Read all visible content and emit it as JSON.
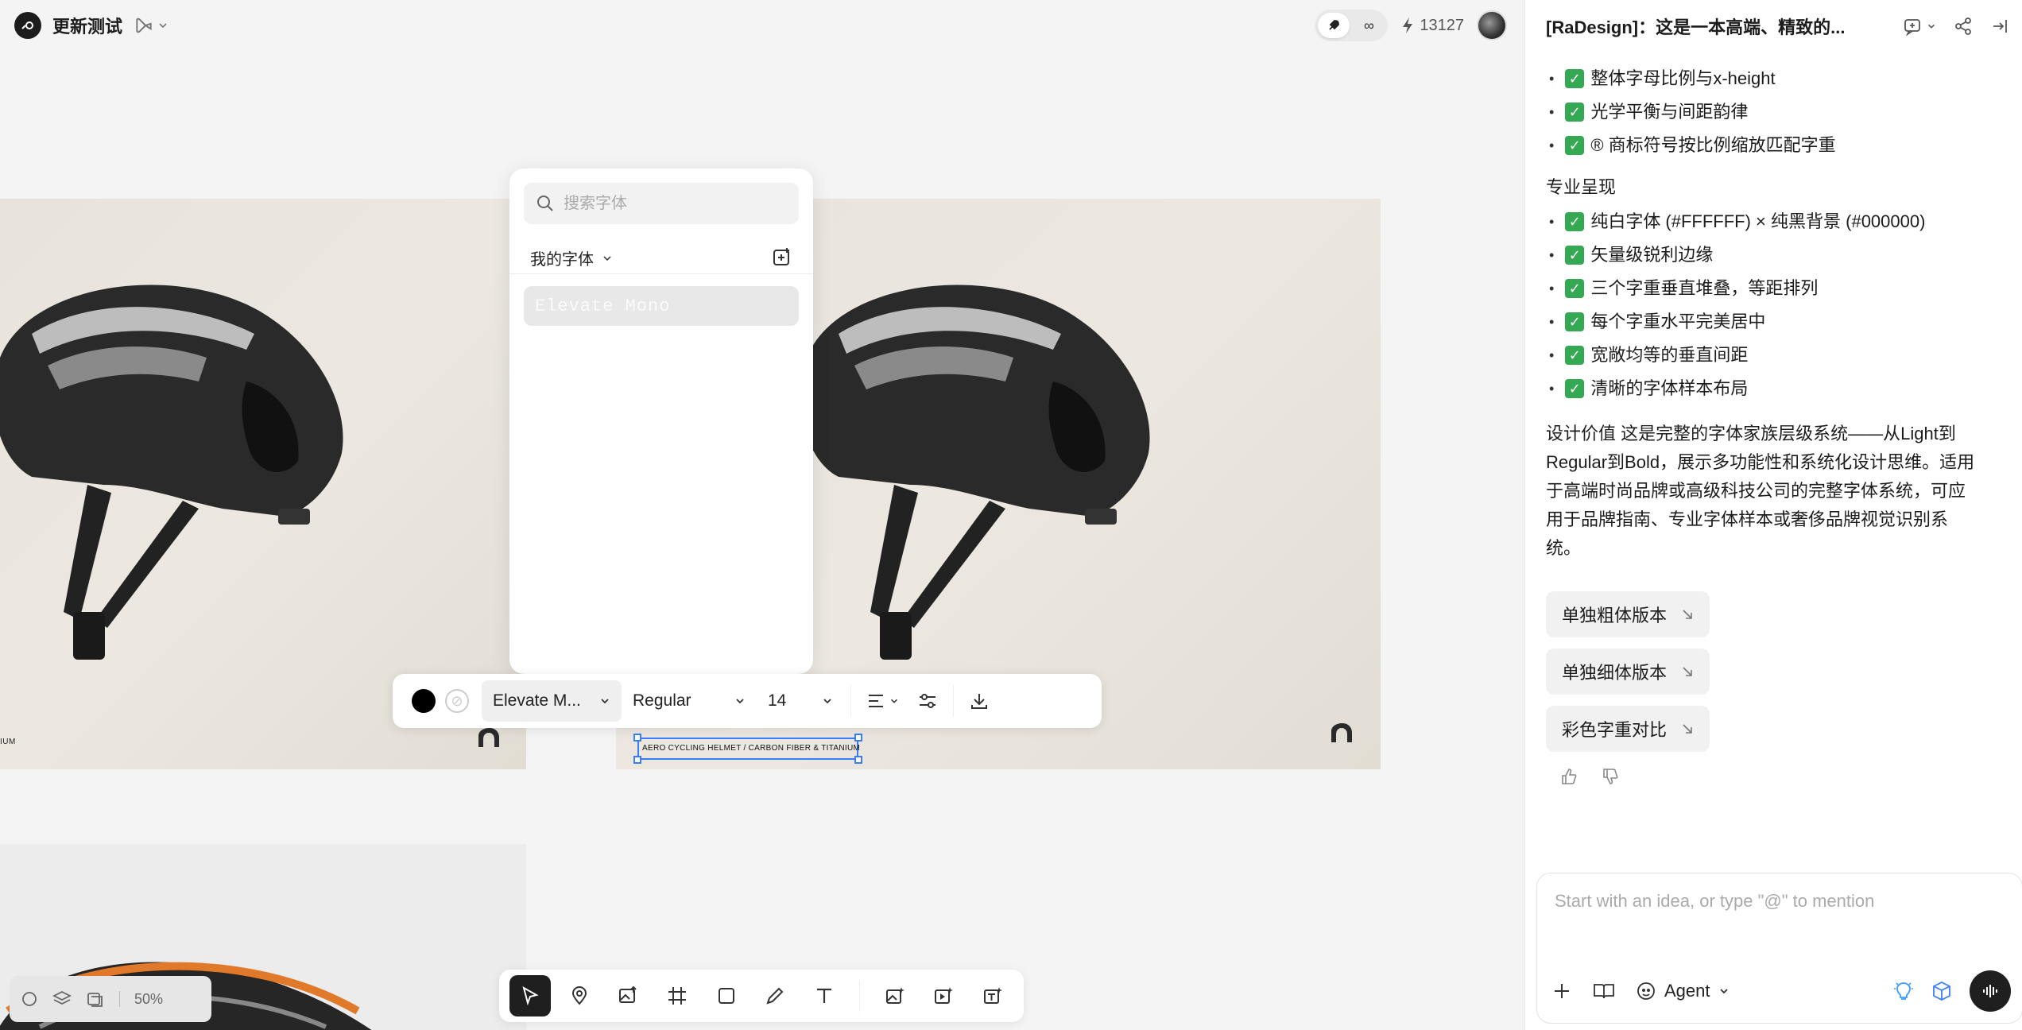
{
  "project": {
    "title": "更新测试"
  },
  "topbar": {
    "credits": "13127",
    "mode_infinite": "∞"
  },
  "canvas": {
    "caption_left_tail": "IUM",
    "caption_selected": "AERO CYCLING HELMET / CARBON FIBER & TITANIUM"
  },
  "font_panel": {
    "search_placeholder": "搜索字体",
    "filter_label": "我的字体",
    "items": [
      "Elevate Mono"
    ]
  },
  "text_toolbar": {
    "font": "Elevate M...",
    "weight": "Regular",
    "size": "14"
  },
  "zoom": {
    "level": "50%"
  },
  "chat": {
    "title": "[RaDesign]：这是一本高端、精致的...",
    "list1": [
      "整体字母比例与x-height",
      "光学平衡与间距韵律",
      "® 商标符号按比例缩放匹配字重"
    ],
    "section2": "专业呈现",
    "list2": [
      "纯白字体 (#FFFFFF) × 纯黑背景 (#000000)",
      "矢量级锐利边缘",
      "三个字重垂直堆叠，等距排列",
      "每个字重水平完美居中",
      "宽敞均等的垂直间距",
      "清晰的字体样本布局"
    ],
    "paragraph": "设计价值 这是完整的字体家族层级系统——从Light到Regular到Bold，展示多功能性和系统化设计思维。适用于高端时尚品牌或高级科技公司的完整字体系统，可应用于品牌指南、专业字体样本或奢侈品牌视觉识别系统。",
    "suggestions": [
      "单独粗体版本",
      "单独细体版本",
      "彩色字重对比"
    ],
    "input_placeholder": "Start with an idea, or type \"@\" to mention",
    "agent_label": "Agent"
  },
  "colors": {
    "accent": "#3b7cff",
    "check": "#34a853",
    "frame_bg": "#e8e4dc"
  }
}
